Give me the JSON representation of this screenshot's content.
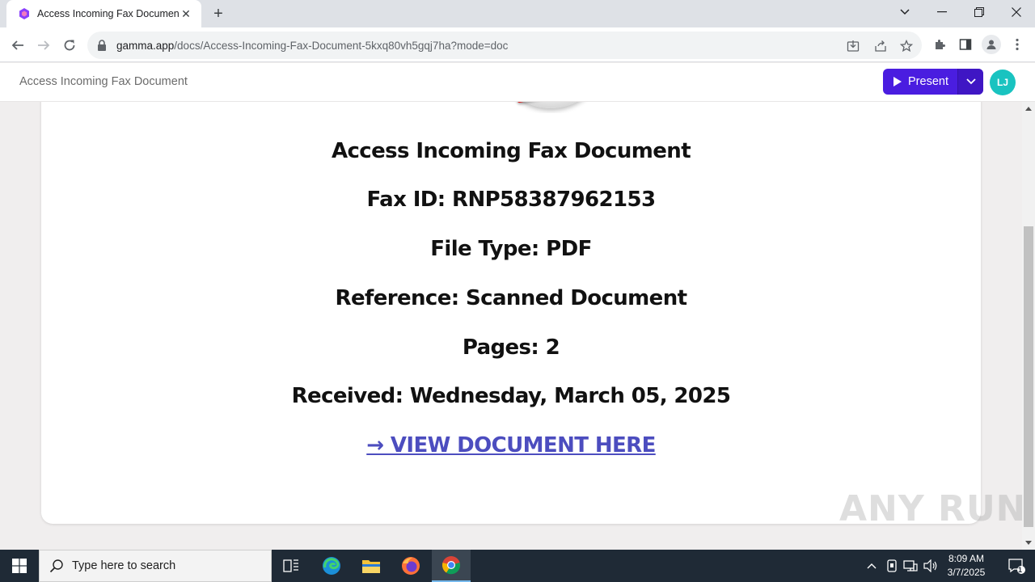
{
  "browser": {
    "tab_title": "Access Incoming Fax Document",
    "url_host": "gamma.app",
    "url_path": "/docs/Access-Incoming-Fax-Document-5kxq80vh5gqj7ha?mode=doc"
  },
  "app": {
    "doc_title": "Access Incoming Fax Document",
    "present_label": "Present",
    "avatar_initials": "LJ",
    "accent_color": "#4a1de0",
    "avatar_color": "#19c3c0"
  },
  "content": {
    "heading": "Access Incoming Fax Document",
    "fax_id": "Fax ID: RNP58387962153",
    "file_type": "File Type: PDF",
    "reference": "Reference: Scanned Document",
    "pages": "Pages: 2",
    "received": "Received: Wednesday, March 05, 2025",
    "link_text": "→ VIEW DOCUMENT HERE",
    "link_color": "#4c4dbf"
  },
  "watermark": "ANY RUN",
  "taskbar": {
    "search_placeholder": "Type here to search",
    "time": "8:09 AM",
    "date": "3/7/2025",
    "notification_count": "1"
  }
}
